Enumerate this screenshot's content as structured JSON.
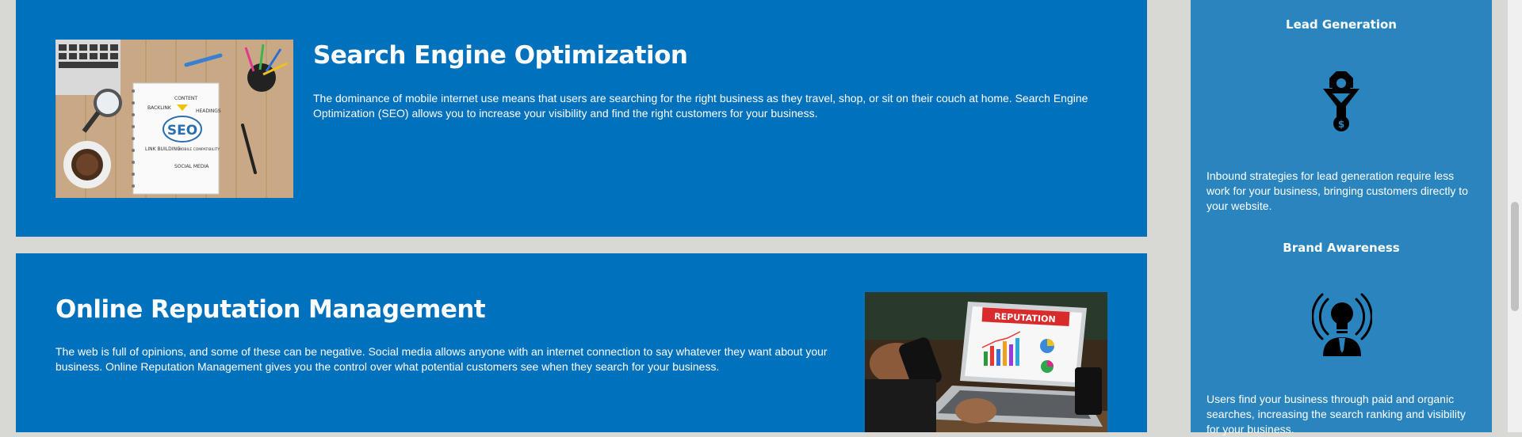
{
  "services": [
    {
      "title": "Search Engine Optimization",
      "description": "The dominance of mobile internet use means that users are searching for the right business as they travel, shop, or sit on their couch at home. Search Engine Optimization (SEO) allows you to increase your visibility and find the right customers for your business.",
      "image_text": {
        "center": "SEO",
        "labels": [
          "CONTENT",
          "BACKLINK",
          "HEADINGS",
          "LINK BUILDING",
          "MOBILE COMPATIBILITY",
          "SOCIAL MEDIA"
        ]
      }
    },
    {
      "title": "Online Reputation Management",
      "description": "The web is full of opinions, and some of these can be negative. Social media allows anyone with an internet connection to say whatever they want about your business. Online Reputation Management gives you the control over what potential customers see when they search for your business.",
      "image_text": {
        "banner": "REPUTATION"
      }
    }
  ],
  "sidebar": {
    "features": [
      {
        "title": "Lead Generation",
        "icon": "funnel-gear-dollar-icon",
        "description": "Inbound strategies for lead generation require less work for your business, bringing customers directly to your website."
      },
      {
        "title": "Brand Awareness",
        "icon": "lightbulb-broadcast-person-icon",
        "description": "Users find your business through paid and organic searches, increasing the search ranking and visibility for your business."
      }
    ]
  },
  "colors": {
    "card_background": "#0071bc",
    "sidebar_background": "#2a85bf",
    "page_background": "#d8d9d4",
    "text": "#ffffff"
  }
}
